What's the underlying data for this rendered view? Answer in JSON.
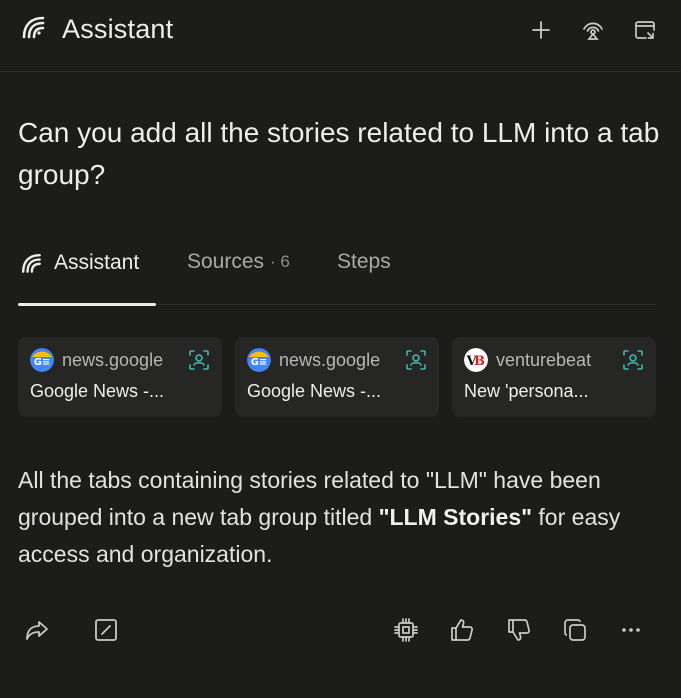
{
  "header": {
    "title": "Assistant",
    "logo_icon": "perplexity-swirl-icon",
    "actions": [
      {
        "name": "new-thread-button",
        "icon": "plus-icon"
      },
      {
        "name": "broadcast-button",
        "icon": "signal-icon"
      },
      {
        "name": "open-window-button",
        "icon": "window-arrow-icon"
      }
    ]
  },
  "question": "Can you add all the stories related to LLM into a tab group?",
  "tabs": [
    {
      "label": "Assistant",
      "icon": "perplexity-swirl-icon",
      "active": true
    },
    {
      "label": "Sources",
      "count": "· 6",
      "active": false
    },
    {
      "label": "Steps",
      "active": false
    }
  ],
  "sources": [
    {
      "domain": "news.google",
      "title": "Google News -...",
      "favicon": "google-news-icon"
    },
    {
      "domain": "news.google",
      "title": "Google News -...",
      "favicon": "google-news-icon"
    },
    {
      "domain": "venturebeat",
      "title": "New 'persona...",
      "favicon": "venturebeat-icon"
    }
  ],
  "answer": {
    "part1": "All the tabs containing stories related to \"LLM\" have been grouped into a new tab group titled ",
    "bold": "\"LLM Stories\"",
    "part2": " for easy access and organization."
  },
  "footer_actions": [
    "share-icon",
    "edit-icon",
    "cpu-icon",
    "thumbs-up-icon",
    "thumbs-down-icon",
    "copy-icon",
    "more-icon"
  ],
  "colors": {
    "background": "#1c1c1b",
    "card": "#262625",
    "teal_accent": "#3fb7b7",
    "text": "#ededea"
  }
}
